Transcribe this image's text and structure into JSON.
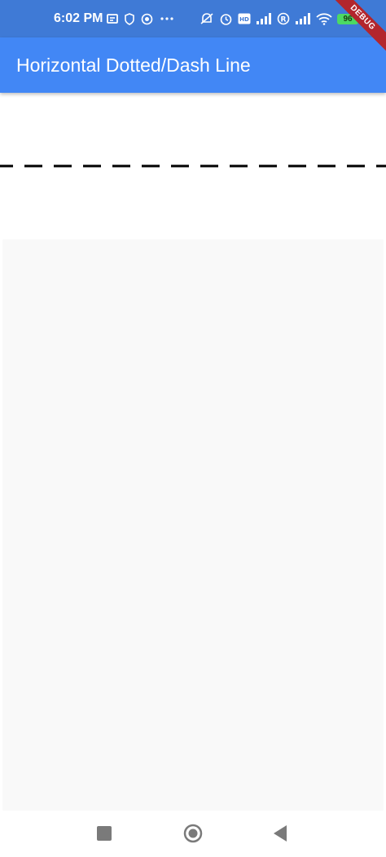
{
  "status_bar": {
    "time": "6:02 PM",
    "battery": "96",
    "left_icons": [
      "notification-icon",
      "shield-icon",
      "settings-icon",
      "more-icon"
    ],
    "right_icons": [
      "mute-icon",
      "alarm-icon",
      "volte-icon",
      "signal-icon",
      "roaming-icon",
      "signal-icon",
      "wifi-icon",
      "battery-icon"
    ],
    "color": "#3f7ad6"
  },
  "app_bar": {
    "title": "Horizontal Dotted/Dash Line",
    "color": "#4287f5"
  },
  "debug_banner": {
    "label": "DEBUG",
    "color": "#b3262d"
  },
  "content": {
    "line_color": "#000000",
    "list_background": "#f9f9f9"
  },
  "nav_bar": {
    "buttons": [
      "recents-square-icon",
      "home-circle-icon",
      "back-triangle-icon"
    ]
  }
}
